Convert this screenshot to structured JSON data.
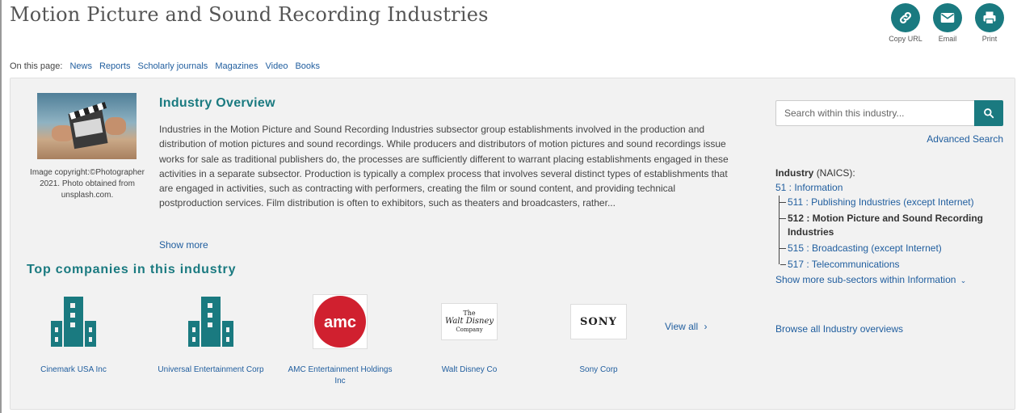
{
  "title": "Motion Picture and Sound Recording Industries",
  "actions": [
    {
      "label": "Copy URL",
      "icon": "link-icon"
    },
    {
      "label": "Email",
      "icon": "envelope-icon"
    },
    {
      "label": "Print",
      "icon": "printer-icon"
    }
  ],
  "on_page": {
    "label": "On this page:",
    "links": [
      "News",
      "Reports",
      "Scholarly journals",
      "Magazines",
      "Video",
      "Books"
    ]
  },
  "image": {
    "caption": "Image copyright:©Photographer 2021. Photo obtained from unsplash.com."
  },
  "overview": {
    "title": "Industry Overview",
    "text": "Industries in the Motion Picture and Sound Recording Industries subsector group establishments involved in the production and distribution of motion pictures and sound recordings. While producers and distributors of motion pictures and sound recordings issue works for sale as traditional publishers do, the processes are sufficiently different to warrant placing establishments engaged in these activities in a separate subsector. Production is typically a complex process that involves several distinct types of establishments that are engaged in activities, such as contracting with performers, creating the film or sound content, and providing technical postproduction services. Film distribution is often to exhibitors, such as theaters and broadcasters, rather...",
    "show_more": "Show more"
  },
  "top_companies": {
    "title": "Top companies in this industry",
    "view_all": "View all",
    "companies": [
      {
        "name": "Cinemark USA Inc",
        "logo": "building-icon"
      },
      {
        "name": "Universal Entertainment Corp",
        "logo": "building-icon"
      },
      {
        "name": "AMC Entertainment Holdings Inc",
        "logo": "amc-logo",
        "logo_text": "amc"
      },
      {
        "name": "Walt Disney Co",
        "logo": "disney-logo",
        "logo_text": "The Walt Disney Company"
      },
      {
        "name": "Sony Corp",
        "logo": "sony-logo",
        "logo_text": "SONY"
      }
    ]
  },
  "search": {
    "placeholder": "Search within this industry...",
    "advanced": "Advanced Search"
  },
  "industry": {
    "label": "Industry",
    "code_system": "(NAICS):",
    "root": "51 : Information",
    "subsectors": [
      {
        "label": "511 : Publishing Industries (except Internet)",
        "current": false
      },
      {
        "label": "512 : Motion Picture and Sound Recording Industries",
        "current": true
      },
      {
        "label": "515 : Broadcasting (except Internet)",
        "current": false
      },
      {
        "label": "517 : Telecommunications",
        "current": false
      }
    ],
    "show_more": "Show more sub-sectors within Information",
    "browse_all": "Browse all Industry overviews"
  },
  "colors": {
    "accent": "#1a7a80",
    "link": "#1f5d9e",
    "amc_red": "#d0202f"
  }
}
